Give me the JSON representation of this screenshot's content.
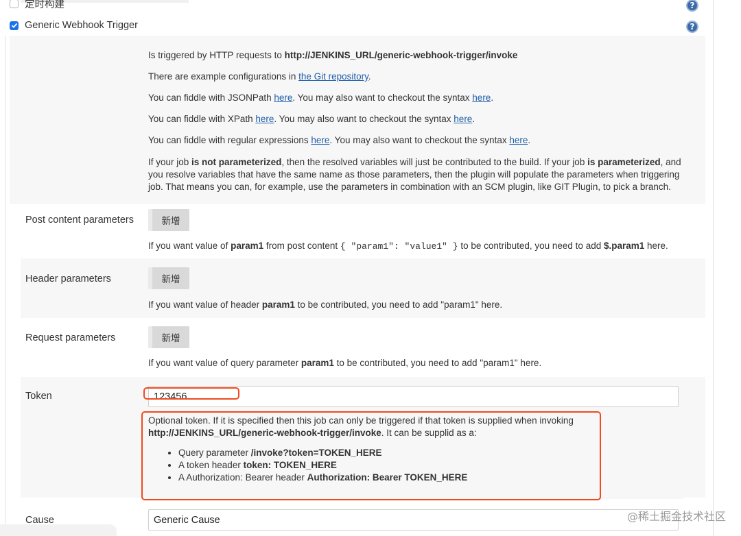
{
  "trigger_options": {
    "scheduled_build_label": "定时构建",
    "scheduled_build_checked": false,
    "webhook_label": "Generic Webhook Trigger",
    "webhook_checked": true
  },
  "description": {
    "p1_text": "Is triggered by HTTP requests to ",
    "p1_bold": "http://JENKINS_URL/generic-webhook-trigger/invoke",
    "p2_text": "There are example configurations in ",
    "p2_link": "the Git repository",
    "p2_end": ".",
    "p3_text": "You can fiddle with JSONPath ",
    "p3_link1": "here",
    "p3_mid": ". You may also want to checkout the syntax ",
    "p3_link2": "here",
    "p3_end": ".",
    "p4_text": "You can fiddle with XPath ",
    "p4_link1": "here",
    "p4_mid": ". You may also want to checkout the syntax ",
    "p4_link2": "here",
    "p4_end": ".",
    "p5_text": "You can fiddle with regular expressions ",
    "p5_link1": "here",
    "p5_mid": ". You may also want to checkout the syntax ",
    "p5_link2": "here",
    "p5_end": ".",
    "p6_a": "If your job ",
    "p6_b": "is not parameterized",
    "p6_c": ", then the resolved variables will just be contributed to the build. If your job ",
    "p6_d": "is parameterized",
    "p6_e": ", and you resolve variables that have the same name as those parameters, then the plugin will populate the parameters when triggering job. That means you can, for example, use the parameters in combination with an SCM plugin, like GIT Plugin, to pick a branch."
  },
  "post_content": {
    "label": "Post content parameters",
    "add_button": "新增",
    "hint_a": "If you want value of ",
    "hint_bold": "param1",
    "hint_b": " from post content ",
    "hint_code": "{ \"param1\": \"value1\" }",
    "hint_c": " to be contributed, you need to add ",
    "hint_bold2": "$.param1",
    "hint_d": " here."
  },
  "header_params": {
    "label": "Header parameters",
    "add_button": "新增",
    "hint_a": "If you want value of header ",
    "hint_bold": "param1",
    "hint_b": " to be contributed, you need to add \"param1\" here."
  },
  "request_params": {
    "label": "Request parameters",
    "add_button": "新增",
    "hint_a": "If you want value of query parameter ",
    "hint_bold": "param1",
    "hint_b": " to be contributed, you need to add \"param1\" here."
  },
  "token": {
    "label": "Token",
    "value": "123456",
    "help_a": "Optional token. If it is specified then this job can only be triggered if that token is supplied when invoking",
    "help_bold": "http://JENKINS_URL/generic-webhook-trigger/invoke",
    "help_b": ". It can be supplid as a:",
    "bullets": [
      {
        "text": "Query parameter ",
        "bold": "/invoke?token=TOKEN_HERE"
      },
      {
        "text": "A token header ",
        "bold": "token: TOKEN_HERE"
      },
      {
        "text": "A Authorization: Bearer header ",
        "bold": "Authorization: Bearer TOKEN_HERE"
      }
    ]
  },
  "cause": {
    "label": "Cause",
    "value": "Generic Cause"
  },
  "watermark": "@稀土掘金技术社区",
  "colors": {
    "accent_link": "#1f5fa8",
    "checkbox_blue": "#1a73e8",
    "annotation_red": "#ee4a1e",
    "help_icon": "#3d6aa8"
  }
}
